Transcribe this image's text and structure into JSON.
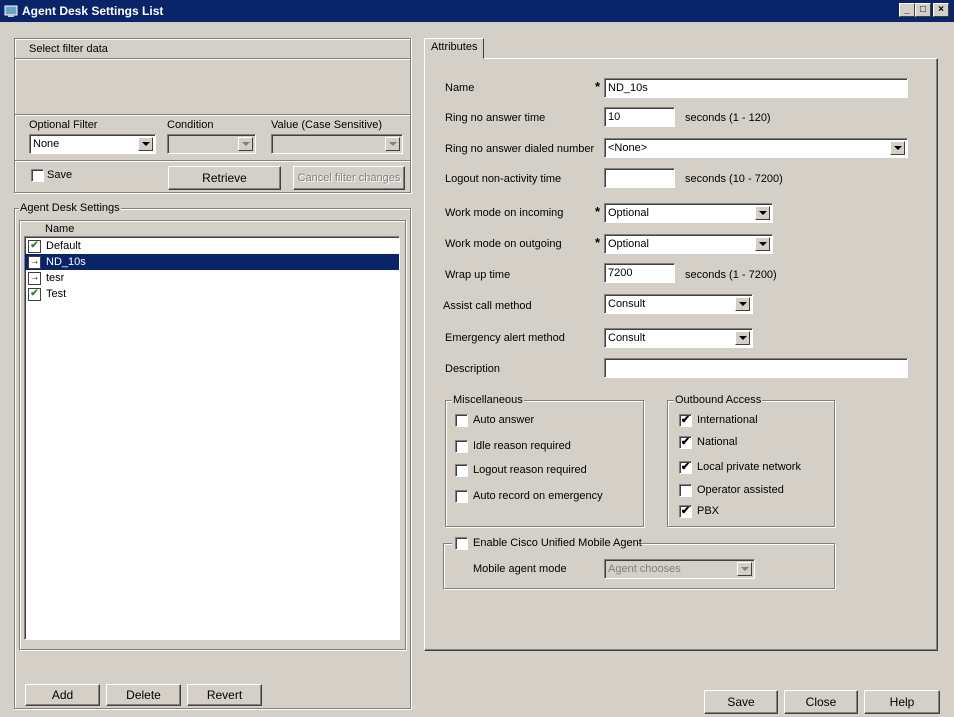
{
  "window": {
    "title": "Agent Desk Settings List",
    "controls": [
      "_",
      "□",
      "×"
    ]
  },
  "filter": {
    "group_label": "Select filter data",
    "optional_filter_label": "Optional Filter",
    "optional_filter_value": "None",
    "condition_label": "Condition",
    "value_label": "Value (Case Sensitive)",
    "save_label": "Save",
    "retrieve_label": "Retrieve",
    "cancel_label": "Cancel filter changes"
  },
  "list": {
    "group_label": "Agent Desk Settings",
    "column_name": "Name",
    "items": [
      {
        "name": "Default",
        "icon": "checkmark-icon",
        "selected": false
      },
      {
        "name": "ND_10s",
        "icon": "arrow-icon",
        "selected": true
      },
      {
        "name": "tesr",
        "icon": "arrow-icon",
        "selected": false
      },
      {
        "name": "Test",
        "icon": "checkmark-icon",
        "selected": false
      }
    ],
    "add_label": "Add",
    "delete_label": "Delete",
    "revert_label": "Revert"
  },
  "attributes": {
    "tab_label": "Attributes",
    "name_label": "Name",
    "name_value": "ND_10s",
    "ring_label": "Ring no answer time",
    "ring_value": "10",
    "ring_hint": "seconds (1 - 120)",
    "ring_dialed_label": "Ring no answer dialed number",
    "ring_dialed_value": "<None>",
    "logout_label": "Logout non-activity time",
    "logout_value": "",
    "logout_hint": "seconds (10 - 7200)",
    "work_in_label": "Work mode on incoming",
    "work_in_value": "Optional",
    "work_out_label": "Work mode on outgoing",
    "work_out_value": "Optional",
    "wrap_label": "Wrap up time",
    "wrap_value": "7200",
    "wrap_hint": "seconds (1 - 7200)",
    "assist_label": "Assist call method",
    "assist_value": "Consult",
    "emergency_label": "Emergency alert method",
    "emergency_value": "Consult",
    "description_label": "Description",
    "description_value": "",
    "required_marker": "*"
  },
  "misc": {
    "group_label": "Miscellaneous",
    "items": [
      {
        "label": "Auto answer",
        "checked": false
      },
      {
        "label": "Idle reason required",
        "checked": false
      },
      {
        "label": "Logout reason required",
        "checked": false
      },
      {
        "label": "Auto record on emergency",
        "checked": false
      }
    ]
  },
  "outbound": {
    "group_label": "Outbound Access",
    "items": [
      {
        "label": "International",
        "checked": true
      },
      {
        "label": "National",
        "checked": true
      },
      {
        "label": "Local private network",
        "checked": true
      },
      {
        "label": "Operator assisted",
        "checked": false
      },
      {
        "label": "PBX",
        "checked": true
      }
    ]
  },
  "mobile": {
    "enable_label": "Enable Cisco Unified Mobile Agent",
    "mode_label": "Mobile agent mode",
    "mode_value": "Agent chooses"
  },
  "footer": {
    "save_label": "Save",
    "close_label": "Close",
    "help_label": "Help"
  },
  "check_glyph": "✔"
}
